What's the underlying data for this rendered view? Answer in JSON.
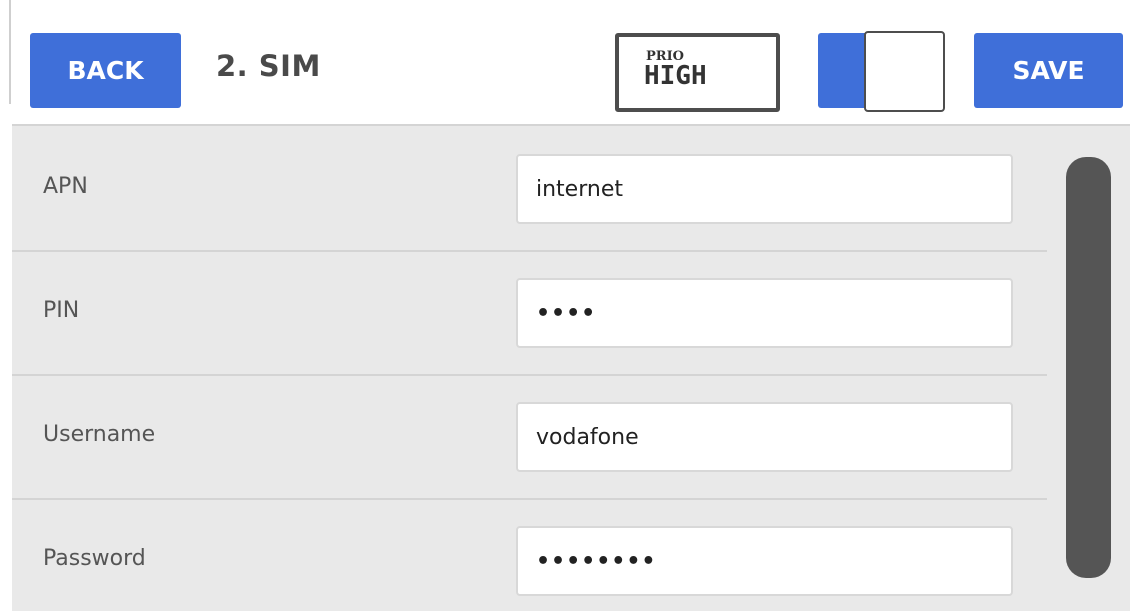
{
  "header": {
    "back_label": "BACK",
    "title": "2. SIM",
    "prio": {
      "small_label": "PRIO",
      "level": "HIGH"
    },
    "toggle": {
      "state": "on"
    },
    "save_label": "SAVE"
  },
  "form": {
    "rows": [
      {
        "label": "APN",
        "value": "internet"
      },
      {
        "label": "PIN",
        "value": "••••"
      },
      {
        "label": "Username",
        "value": "vodafone"
      },
      {
        "label": "Password",
        "value": "••••••••"
      }
    ]
  },
  "colors": {
    "accent": "#3f6fd9",
    "background": "#e9e9e9",
    "scrollbar": "#555555"
  }
}
